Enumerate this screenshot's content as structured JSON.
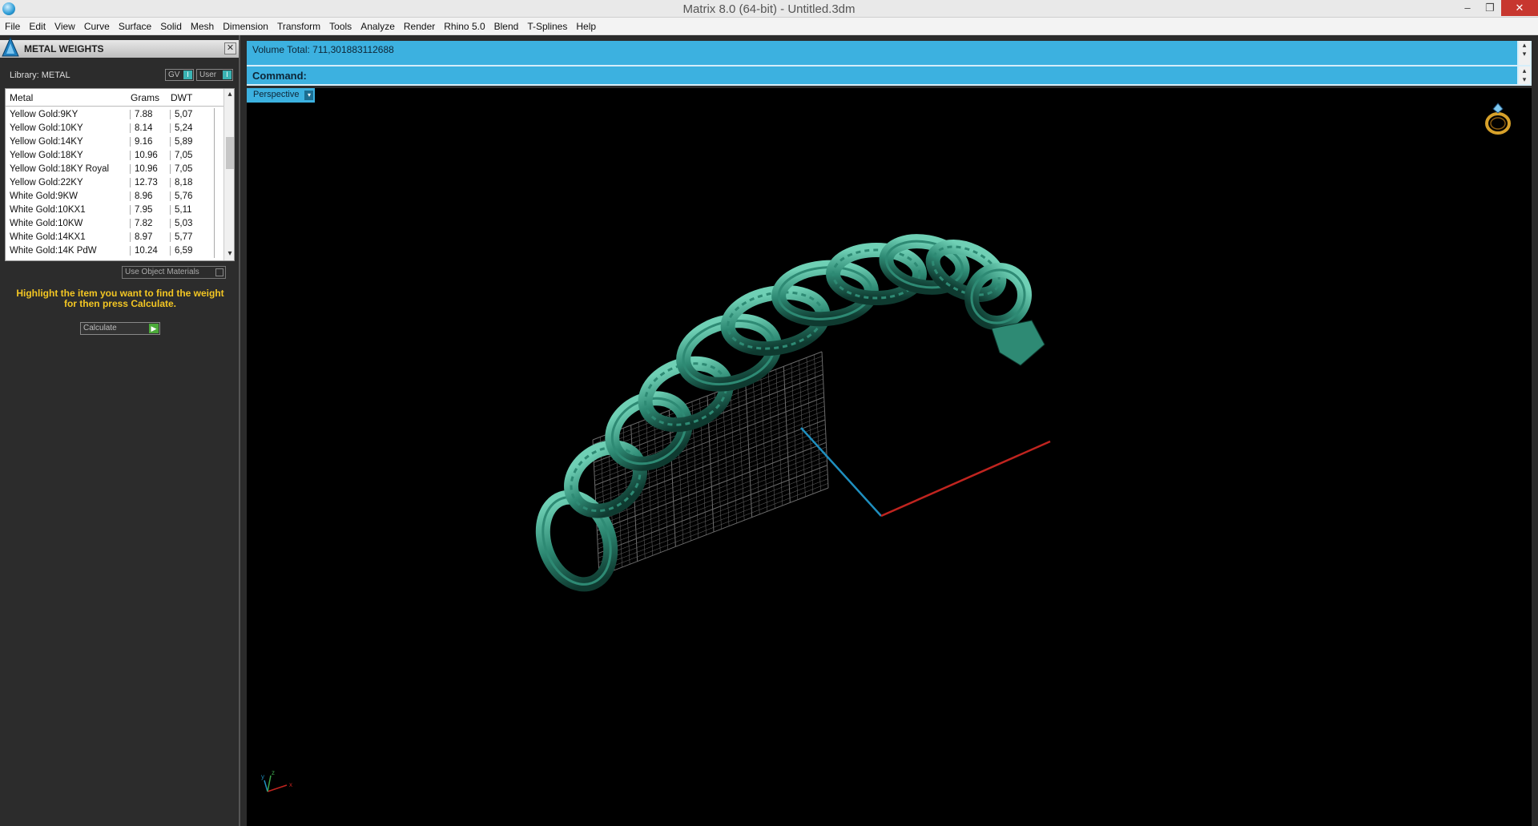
{
  "window": {
    "title": "Matrix 8.0 (64-bit) - Untitled.3dm",
    "min": "–",
    "max": "❐",
    "close": "✕"
  },
  "menu": [
    "File",
    "Edit",
    "View",
    "Curve",
    "Surface",
    "Solid",
    "Mesh",
    "Dimension",
    "Transform",
    "Tools",
    "Analyze",
    "Render",
    "Rhino 5.0",
    "Blend",
    "T-Splines",
    "Help"
  ],
  "panel": {
    "title": "METAL WEIGHTS",
    "close": "✕",
    "library": "Library: METAL",
    "gv_label": "GV",
    "user_label": "User",
    "table": {
      "headers": [
        "Metal",
        "Grams",
        "DWT"
      ],
      "rows": [
        [
          "Yellow Gold:9KY",
          "7.88",
          "5,07"
        ],
        [
          "Yellow Gold:10KY",
          "8.14",
          "5,24"
        ],
        [
          "Yellow Gold:14KY",
          "9.16",
          "5,89"
        ],
        [
          "Yellow Gold:18KY",
          "10.96",
          "7,05"
        ],
        [
          "Yellow Gold:18KY Royal",
          "10.96",
          "7,05"
        ],
        [
          "Yellow Gold:22KY",
          "12.73",
          "8,18"
        ],
        [
          "White Gold:9KW",
          "8.96",
          "5,76"
        ],
        [
          "White Gold:10KX1",
          "7.95",
          "5,11"
        ],
        [
          "White Gold:10KW",
          "7.82",
          "5,03"
        ],
        [
          "White Gold:14KX1",
          "8.97",
          "5,77"
        ],
        [
          "White Gold:14K PdW",
          "10.24",
          "6,59"
        ]
      ]
    },
    "use_object_materials": "Use Object Materials",
    "hint": "Highlight the item you want to find the weight for then press Calculate.",
    "calculate": "Calculate"
  },
  "command": {
    "history": "Volume Total: 711,301883112688",
    "prompt": "Command:"
  },
  "viewport": {
    "name": "Perspective",
    "model_color": "#2e8a74",
    "grid_color": "#6b6b6b",
    "x_axis_color": "#c0241f",
    "y_axis_color": "#1f8fbf"
  }
}
